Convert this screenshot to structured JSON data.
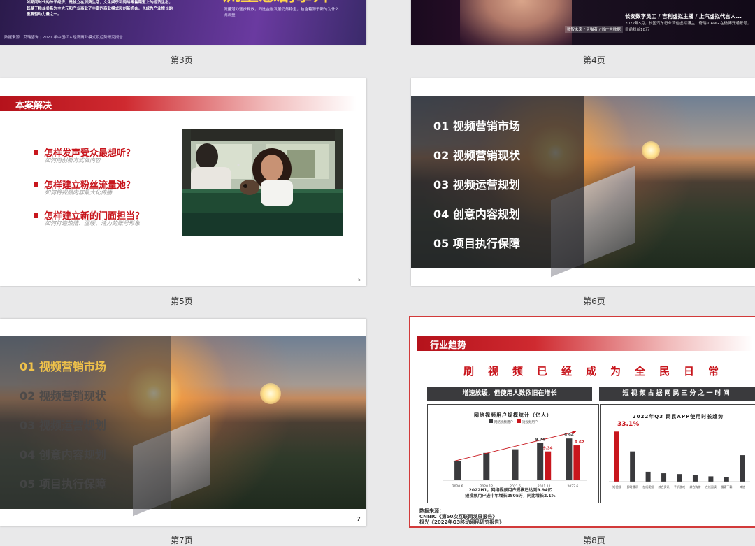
{
  "slides": {
    "s3": {
      "caption": "第3页",
      "partial_title": "流量急剧攀升",
      "body_left": "如斯同时代的分子经济，是独立在消费生活，文化娱乐和网络零售渠道上的经济生态，其基于粉丝关系为主大元和产业商业了丰富的商业模式和创新机会，也成为产业增长的重要驱动力量之一。",
      "body_right": "流量潜力逐步释放，同比金融发展仍然稳重，包含着源于新的为什么流流量",
      "source": "数据来源：艾瑞咨询 | 2021 年中国红人经济商业模式及趋势研究报告"
    },
    "s4": {
      "caption": "第4页",
      "tag": "数智未来 / 天猫者 / 省广大数据",
      "line1": "长安数字员工 / 吉利虚拟主播 / 上汽虚拟代言人...",
      "line2": "2022年5月，长国汽车行业首位虚拟博主：奇瑞-CANG 在微博开通账号，目前粉丝18万"
    },
    "s5": {
      "caption": "第5页",
      "header": "本案解决",
      "page_num": "5",
      "questions": [
        {
          "title": "怎样发声受众最想听？",
          "sub": "如何用创新方式做内容"
        },
        {
          "title": "怎样建立粉丝流量池？",
          "sub": "如何将视频内容最大化传播"
        },
        {
          "title": "怎样建立新的门面担当？",
          "sub": "如何打造热情、温暖、活力的账号形象"
        }
      ]
    },
    "s6": {
      "caption": "第6页",
      "menu": [
        "01  视频营销市场",
        "02  视频营销现状",
        "03  视频运营规划",
        "04  创意内容规划",
        "05  项目执行保障"
      ]
    },
    "s7": {
      "caption": "第7页",
      "page_num": "7",
      "menu": [
        "01  视频营销市场",
        "02  视频营销现状",
        "03  视频运营规划",
        "04  创意内容规划",
        "05  项目执行保障"
      ]
    },
    "s8": {
      "caption": "第8页",
      "header": "行业趋势",
      "headline": "刷视频已经成为全民日常",
      "left_hdr": "增速放缓，但使用人数依旧在增长",
      "right_hdr": "短视频占据网民三分之一时间",
      "summary_l1": "2022H1，网络视频用户规模已达到9.94亿",
      "summary_l2": "短视频用户进中年增长2805万，同比增长2.1%",
      "source_l1": "数据来源：",
      "source_l2": "CNNIC《第50次互联网发展报告》",
      "source_l3": "极光《2022年Q3移动网民研究报告》"
    }
  },
  "chart_data": [
    {
      "type": "bar",
      "title": "网络视频用户规模统计（亿人）",
      "categories": [
        "2020.6",
        "2020.12",
        "2021.6",
        "2021.12",
        "2022.6"
      ],
      "series": [
        {
          "name": "网络视频用户",
          "color": "#3a3a3d",
          "values": [
            8.88,
            9.27,
            9.44,
            9.74,
            9.94
          ]
        },
        {
          "name": "短视频用户",
          "color": "#c8161d",
          "values": [
            null,
            null,
            null,
            9.34,
            9.62
          ]
        }
      ],
      "data_labels": [
        "9.74",
        "9.34",
        "9.94",
        "9.62"
      ],
      "ylim": [
        8,
        10.4
      ]
    },
    {
      "type": "bar",
      "title": "2022年Q3 网民APP使用时长趋势",
      "highlight": "33.1%",
      "categories": [
        "短视频",
        "即时通讯",
        "在线视频",
        "综合资讯",
        "手机游戏",
        "综合购物",
        "在线阅读",
        "搜索下载",
        "其他"
      ],
      "values": [
        33.1,
        20.0,
        6.5,
        5.5,
        5.0,
        4.2,
        3.5,
        2.8,
        17.5
      ],
      "colors": [
        "#c8161d",
        "#3a3a3d",
        "#3a3a3d",
        "#3a3a3d",
        "#3a3a3d",
        "#3a3a3d",
        "#3a3a3d",
        "#3a3a3d",
        "#3a3a3d"
      ],
      "ylim": [
        0,
        36
      ]
    }
  ]
}
